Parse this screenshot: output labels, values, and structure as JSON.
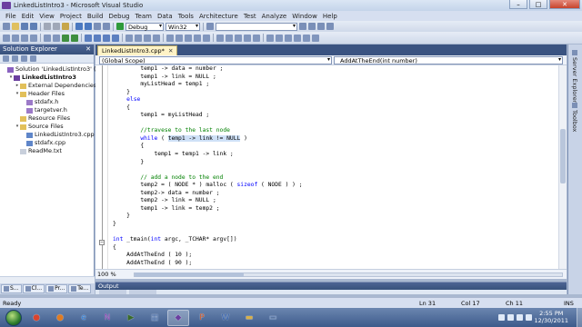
{
  "window": {
    "title": "LinkedListIntro3 - Microsoft Visual Studio",
    "minimize": "–",
    "maximize": "□",
    "close": "✕"
  },
  "menu": [
    "File",
    "Edit",
    "View",
    "Project",
    "Build",
    "Debug",
    "Team",
    "Data",
    "Tools",
    "Architecture",
    "Test",
    "Analyze",
    "Window",
    "Help"
  ],
  "toolbar": {
    "configuration": "Debug",
    "platform": "Win32",
    "find_combo": ""
  },
  "solution_explorer": {
    "title": "Solution Explorer",
    "close": "✕",
    "tree": [
      {
        "label": "Solution 'LinkedListIntro3' (1 proj",
        "indent": 0,
        "arrow": "",
        "icon": "solution-icon"
      },
      {
        "label": "LinkedListIntro3",
        "indent": 1,
        "arrow": "▾",
        "icon": "project-icon"
      },
      {
        "label": "External Dependencies",
        "indent": 2,
        "arrow": "▸",
        "icon": "folder-icon"
      },
      {
        "label": "Header Files",
        "indent": 2,
        "arrow": "▾",
        "icon": "folder-icon"
      },
      {
        "label": "stdafx.h",
        "indent": 3,
        "arrow": "",
        "icon": "header-file-icon"
      },
      {
        "label": "targetver.h",
        "indent": 3,
        "arrow": "",
        "icon": "header-file-icon"
      },
      {
        "label": "Resource Files",
        "indent": 2,
        "arrow": "",
        "icon": "folder-icon"
      },
      {
        "label": "Source Files",
        "indent": 2,
        "arrow": "▾",
        "icon": "folder-icon"
      },
      {
        "label": "LinkedListIntro3.cpp",
        "indent": 3,
        "arrow": "",
        "icon": "cpp-file-icon"
      },
      {
        "label": "stdafx.cpp",
        "indent": 3,
        "arrow": "",
        "icon": "cpp-file-icon"
      },
      {
        "label": "ReadMe.txt",
        "indent": 2,
        "arrow": "",
        "icon": "text-file-icon"
      }
    ],
    "tabs": [
      {
        "label": "S..."
      },
      {
        "label": "Cl..."
      },
      {
        "label": "Pr..."
      },
      {
        "label": "Te..."
      }
    ]
  },
  "editor": {
    "tab": "LinkedListIntro3.cpp*",
    "tab_close": "✕",
    "scope": "(Global Scope)",
    "member": "AddAtTheEnd(int number)",
    "zoom": "100 %"
  },
  "right_bar": [
    "Server Explorer",
    "Toolbox"
  ],
  "output": {
    "title": "Output"
  },
  "status": {
    "ready": "Ready",
    "line": "Ln 31",
    "col": "Col 17",
    "ch": "Ch 11",
    "mode": "INS"
  },
  "taskbar": {
    "apps": [
      {
        "name": "chrome-app",
        "glyph": "●",
        "color": "#d9442f"
      },
      {
        "name": "firefox-app",
        "glyph": "●",
        "color": "#e07b22"
      },
      {
        "name": "ie-app",
        "glyph": "e",
        "color": "#2a7bd6"
      },
      {
        "name": "onenote-app",
        "glyph": "N",
        "color": "#8a3db1"
      },
      {
        "name": "media-app",
        "glyph": "▶",
        "color": "#3a6b2b"
      },
      {
        "name": "paint-app",
        "glyph": "▦",
        "color": "#4a6ea8"
      },
      {
        "name": "visual-studio-app",
        "glyph": "◆",
        "color": "#6b3fa0"
      },
      {
        "name": "powerpoint-app",
        "glyph": "P",
        "color": "#c9562a"
      },
      {
        "name": "word-app",
        "glyph": "W",
        "color": "#2b5aa8"
      },
      {
        "name": "folder-app",
        "glyph": "▬",
        "color": "#d8b04a"
      },
      {
        "name": "window-app",
        "glyph": "▭",
        "color": "#6a8cc0"
      }
    ],
    "time": "2:55 PM",
    "date": "12/30/2011"
  }
}
